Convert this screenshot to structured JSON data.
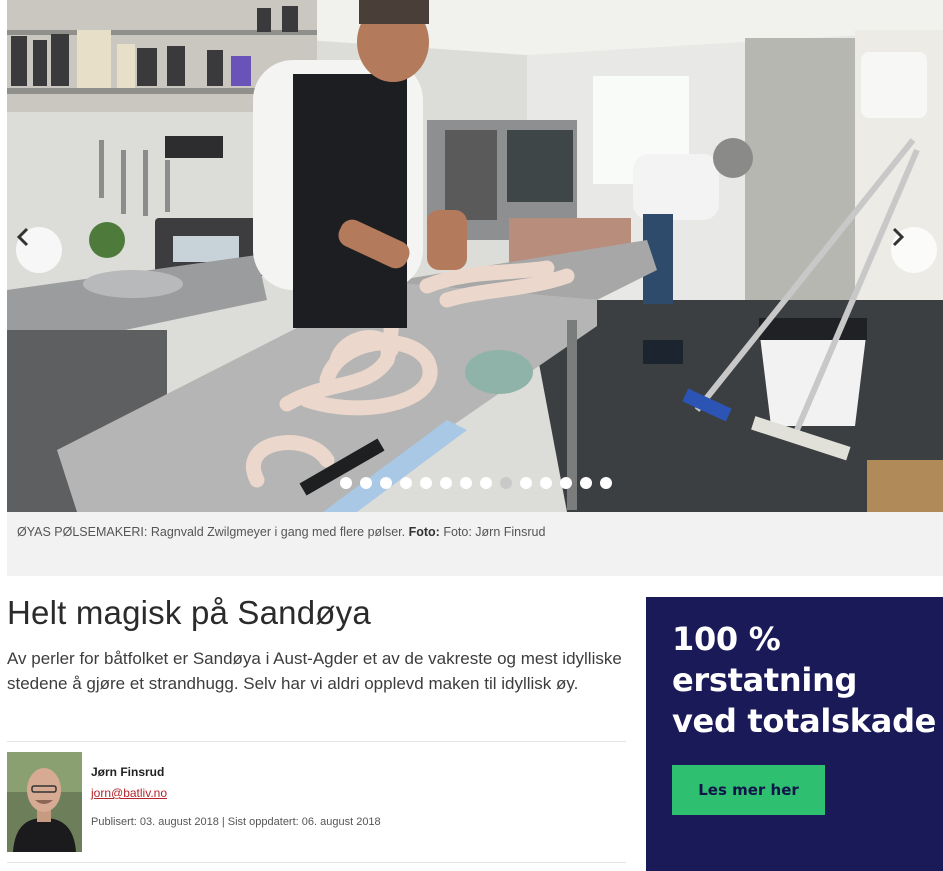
{
  "hero": {
    "slide_count": 14,
    "active_slide": 8
  },
  "caption": {
    "text": "ØYAS PØLSEMAKERI: Ragnvald Zwilgmeyer i gang med flere pølser.",
    "credit_label": "Foto:",
    "credit_text": "Foto: Jørn Finsrud"
  },
  "article": {
    "headline": "Helt magisk på Sandøya",
    "lead": "Av perler for båtfolket er Sandøya i Aust-Agder et av de vakreste og mest idylliske stedene å gjøre et strandhugg. Selv har vi aldri opplevd maken til idyllisk øy."
  },
  "author": {
    "name": "Jørn Finsrud",
    "email": "jorn@batliv.no",
    "published": "Publisert: 03. august 2018 | Sist oppdatert: 06. august 2018"
  },
  "ad": {
    "headline_lines": [
      "100 %",
      "erstatning",
      "ved totalskade"
    ],
    "button_label": "Les mer her",
    "background_color": "#1b1a59",
    "button_color": "#2fbf71"
  },
  "icons": {
    "prev": "chevron-left-icon",
    "next": "chevron-right-icon"
  }
}
